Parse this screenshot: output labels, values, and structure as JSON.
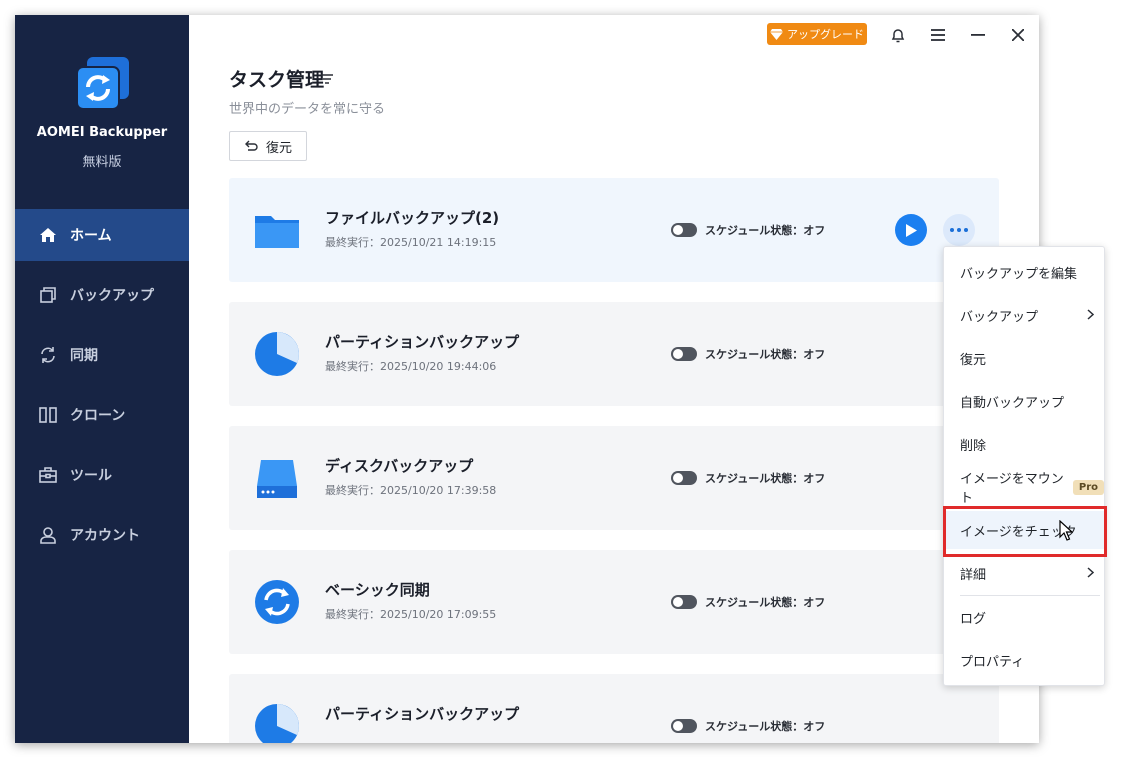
{
  "app": {
    "name": "AOMEI Backupper",
    "edition": "無料版"
  },
  "sidebar": {
    "items": [
      {
        "label": "ホーム",
        "icon": "home-icon",
        "active": true
      },
      {
        "label": "バックアップ",
        "icon": "backup-icon",
        "active": false
      },
      {
        "label": "同期",
        "icon": "sync-icon",
        "active": false
      },
      {
        "label": "クローン",
        "icon": "clone-icon",
        "active": false
      },
      {
        "label": "ツール",
        "icon": "tools-icon",
        "active": false
      },
      {
        "label": "アカウント",
        "icon": "account-icon",
        "active": false
      }
    ]
  },
  "titlebar": {
    "upgrade_label": "アップグレード"
  },
  "header": {
    "title": "タスク管理",
    "subtitle": "世界中のデータを常に守る",
    "restore_label": "復元"
  },
  "tasks": [
    {
      "name": "ファイルバックアップ(2)",
      "last_run": "最終実行：2025/10/21 14:19:15",
      "schedule": "スケジュール状態：オフ",
      "icon": "folder-icon"
    },
    {
      "name": "パーティションバックアップ",
      "last_run": "最終実行：2025/10/20 19:44:06",
      "schedule": "スケジュール状態：オフ",
      "icon": "partition-icon"
    },
    {
      "name": "ディスクバックアップ",
      "last_run": "最終実行：2025/10/20 17:39:58",
      "schedule": "スケジュール状態：オフ",
      "icon": "disk-icon"
    },
    {
      "name": "ベーシック同期",
      "last_run": "最終実行：2025/10/20 17:09:55",
      "schedule": "スケジュール状態：オフ",
      "icon": "sync-task-icon"
    },
    {
      "name": "パーティションバックアップ",
      "last_run": "",
      "schedule": "スケジュール状態：オフ",
      "icon": "partition-icon"
    }
  ],
  "context_menu": {
    "items": [
      {
        "label": "バックアップを編集"
      },
      {
        "label": "バックアップ",
        "submenu": true
      },
      {
        "label": "復元"
      },
      {
        "label": "自動バックアップ"
      },
      {
        "label": "削除"
      },
      {
        "label": "イメージをマウント",
        "badge": "Pro"
      },
      {
        "label": "イメージをチェック",
        "highlighted": true
      },
      {
        "label": "詳細",
        "submenu": true
      },
      {
        "label": "ログ"
      },
      {
        "label": "プロパティ"
      }
    ]
  },
  "colors": {
    "sidebar_bg": "#172444",
    "sidebar_active": "#244a8a",
    "accent_blue": "#1b7ff0",
    "upgrade_orange": "#f08a13",
    "highlight_red": "#e02a2a"
  }
}
